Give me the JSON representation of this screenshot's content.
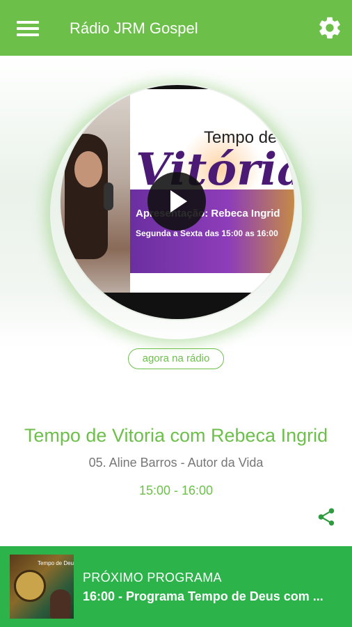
{
  "app_bar": {
    "title": "Rádio JRM Gospel",
    "menu_icon": "hamburger-menu-icon",
    "settings_icon": "gear-icon",
    "background": "#6cc04a"
  },
  "now_playing": {
    "cover": {
      "heading_line1": "Tempo de",
      "heading_line2": "Vitória",
      "presenter_line": "Apresentação: Rebeca Ingrid",
      "schedule_line": "Segunda a Sexta das 15:00 as 16:00"
    },
    "play_icon": "play-icon",
    "badge": "agora na rádio",
    "program_title": "Tempo de Vitoria com Rebeca Ingrid",
    "track": "05. Aline Barros - Autor da Vida",
    "time_range": "15:00 - 16:00",
    "share_icon": "share-icon",
    "accent": "#6cc04a"
  },
  "next_program": {
    "label": "PRÓXIMO PROGRAMA",
    "title": "16:00 - Programa Tempo de Deus com ...",
    "thumb_text": "Tempo de Deus",
    "background": "#2cb34a"
  }
}
